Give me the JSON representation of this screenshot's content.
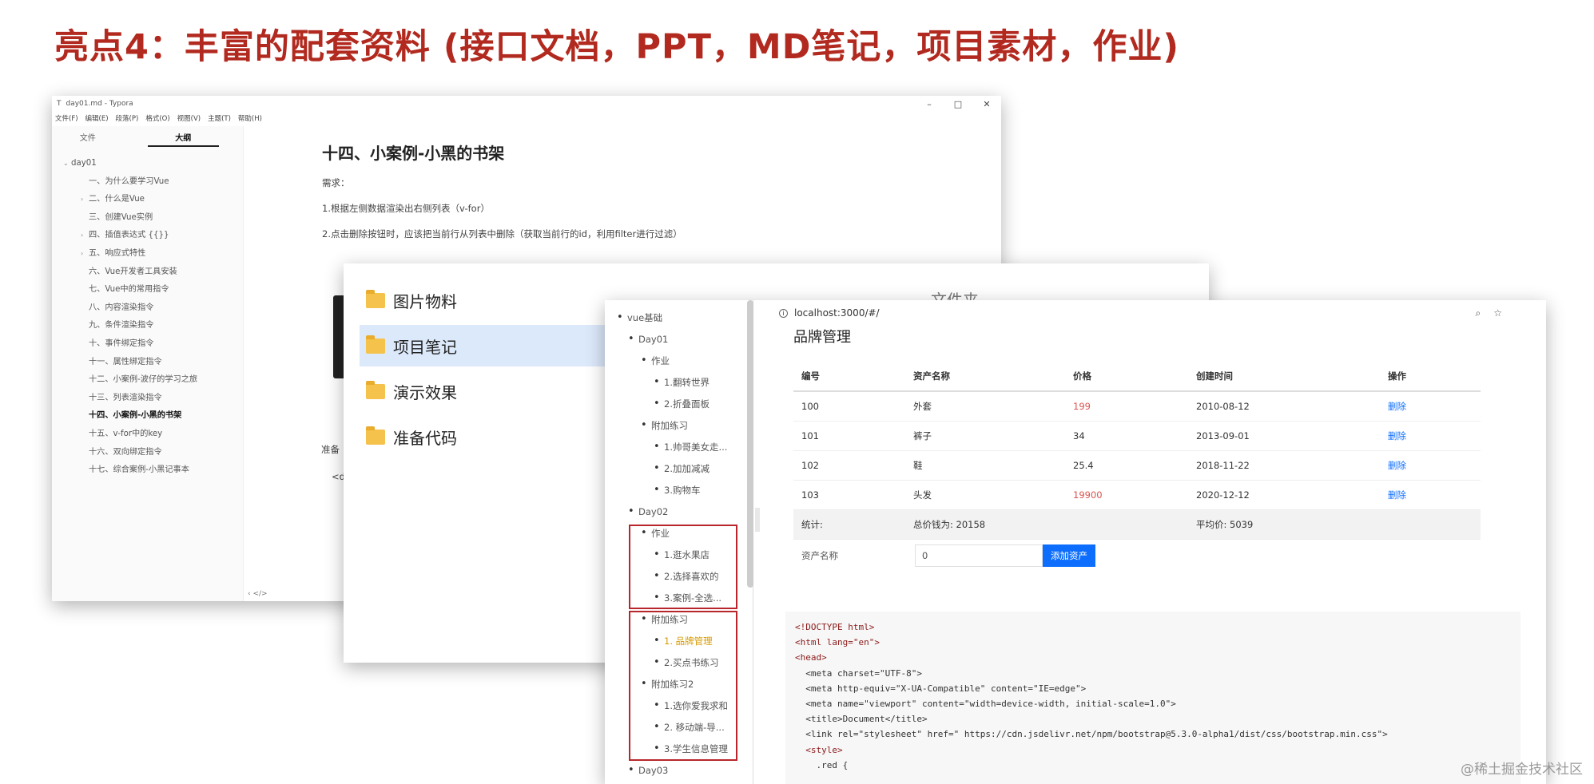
{
  "slide_title": "亮点4：丰富的配套资料 (接口文档，PPT，MD笔记，项目素材，作业)",
  "watermark": "@稀土掘金技术社区",
  "typora": {
    "window_title": "day01.md - Typora",
    "app_icon": "T",
    "controls": [
      "–",
      "□",
      "✕"
    ],
    "menu": [
      "文件(F)",
      "编辑(E)",
      "段落(P)",
      "格式(O)",
      "视图(V)",
      "主题(T)",
      "帮助(H)"
    ],
    "tabs": [
      "文件",
      "大纲"
    ],
    "outline_root": "day01",
    "outline": [
      {
        "label": "一、为什么要学习Vue",
        "arrow": ""
      },
      {
        "label": "二、什么是Vue",
        "arrow": "›"
      },
      {
        "label": "三、创建Vue实例",
        "arrow": ""
      },
      {
        "label": "四、插值表达式 {{}}",
        "arrow": "›"
      },
      {
        "label": "五、响应式特性",
        "arrow": "›"
      },
      {
        "label": "六、Vue开发者工具安装",
        "arrow": ""
      },
      {
        "label": "七、Vue中的常用指令",
        "arrow": ""
      },
      {
        "label": "八、内容渲染指令",
        "arrow": ""
      },
      {
        "label": "九、条件渲染指令",
        "arrow": ""
      },
      {
        "label": "十、事件绑定指令",
        "arrow": ""
      },
      {
        "label": "十一、属性绑定指令",
        "arrow": ""
      },
      {
        "label": "十二、小案例-波仔的学习之旅",
        "arrow": ""
      },
      {
        "label": "十三、列表渲染指令",
        "arrow": ""
      },
      {
        "label": "十四、小案例-小黑的书架",
        "arrow": ""
      },
      {
        "label": "十五、v-for中的key",
        "arrow": ""
      },
      {
        "label": "十六、双向绑定指令",
        "arrow": ""
      },
      {
        "label": "十七、综合案例-小黑记事本",
        "arrow": ""
      }
    ],
    "bottom_icons": "‹   </>",
    "doc_heading": "十四、小案例-小黑的书架",
    "doc_lines": [
      "需求：",
      "1.根据左侧数据渲染出右侧列表（v-for）",
      "2.点击删除按钮时，应该把当前行从列表中删除（获取当前行的id，利用filter进行过滤）"
    ],
    "frag_1": "准备",
    "frag_2": "<d"
  },
  "files": {
    "header": "文件夹",
    "folders": [
      "图片物料",
      "项目笔记",
      "演示效果",
      "准备代码"
    ]
  },
  "tree": [
    {
      "label": "vue基础"
    },
    {
      "label": "Day01"
    },
    {
      "label": "作业"
    },
    {
      "label": "1.翻转世界"
    },
    {
      "label": "2.折叠面板"
    },
    {
      "label": "附加练习"
    },
    {
      "label": "1.帅哥美女走..."
    },
    {
      "label": "2.加加减减"
    },
    {
      "label": "3.购物车"
    },
    {
      "label": "Day02"
    },
    {
      "label": "作业"
    },
    {
      "label": "1.逛水果店"
    },
    {
      "label": "2.选择喜欢的"
    },
    {
      "label": "3.案例-全选..."
    },
    {
      "label": "附加练习"
    },
    {
      "label": "1. 品牌管理"
    },
    {
      "label": "2.买点书练习"
    },
    {
      "label": "附加练习2"
    },
    {
      "label": "1.选你爱我求和"
    },
    {
      "label": "2. 移动端-导..."
    },
    {
      "label": "3.学生信息管理"
    },
    {
      "label": "Day03"
    }
  ],
  "browser": {
    "url": "localhost:3000/#/",
    "tool_icons": [
      "⌕",
      "☆"
    ],
    "page_title": "品牌管理",
    "columns": [
      "编号",
      "资产名称",
      "价格",
      "创建时间",
      "操作"
    ],
    "rows": [
      {
        "id": "100",
        "name": "外套",
        "price": "199",
        "date": "2010-08-12",
        "action": "删除",
        "red": true
      },
      {
        "id": "101",
        "name": "裤子",
        "price": "34",
        "date": "2013-09-01",
        "action": "删除",
        "red": false
      },
      {
        "id": "102",
        "name": "鞋",
        "price": "25.4",
        "date": "2018-11-22",
        "action": "删除",
        "red": false
      },
      {
        "id": "103",
        "name": "头发",
        "price": "19900",
        "date": "2020-12-12",
        "action": "删除",
        "red": true
      }
    ],
    "stats": {
      "label": "统计:",
      "total": "总价钱为: 20158",
      "avg": "平均价: 5039"
    },
    "form": {
      "label": "资产名称",
      "value": "0",
      "button": "添加资产"
    },
    "code_lines": [
      "<!DOCTYPE html>",
      "<html lang=\"en\">",
      "",
      "<head>",
      "  <meta charset=\"UTF-8\">",
      "  <meta http-equiv=\"X-UA-Compatible\" content=\"IE=edge\">",
      "  <meta name=\"viewport\" content=\"width=device-width, initial-scale=1.0\">",
      "  <title>Document</title>",
      "  <link rel=\"stylesheet\" href=\" https://cdn.jsdelivr.net/npm/bootstrap@5.3.0-alpha1/dist/css/bootstrap.min.css\">",
      "  <style>",
      "    .red {"
    ]
  }
}
